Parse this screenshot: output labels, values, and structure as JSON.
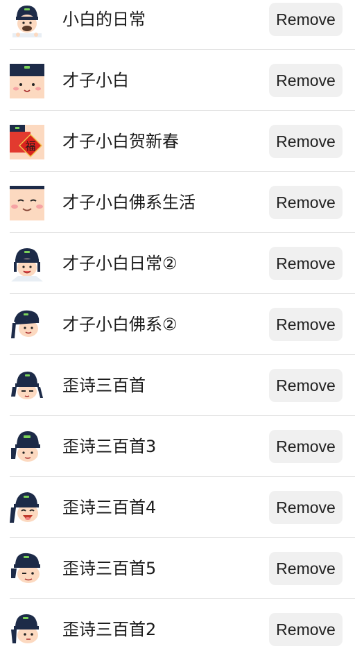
{
  "sticker_list": {
    "remove_label": "Remove",
    "items": [
      {
        "name": "小白的日常",
        "icon": "scholar-eating-icon"
      },
      {
        "name": "才子小白",
        "icon": "scholar-face-icon"
      },
      {
        "name": "才子小白贺新春",
        "icon": "scholar-fu-newyear-icon"
      },
      {
        "name": "才子小白佛系生活",
        "icon": "scholar-smiling-face-icon"
      },
      {
        "name": "才子小白日常②",
        "icon": "scholar-hat-smile-icon"
      },
      {
        "name": "才子小白佛系②",
        "icon": "scholar-tilted-hat-icon"
      },
      {
        "name": "歪诗三百首",
        "icon": "poet-cap-icon"
      },
      {
        "name": "歪诗三百首3",
        "icon": "poet-cap-green-icon"
      },
      {
        "name": "歪诗三百首4",
        "icon": "poet-laughing-icon"
      },
      {
        "name": "歪诗三百首5",
        "icon": "poet-winking-icon"
      },
      {
        "name": "歪诗三百首2",
        "icon": "poet-side-glance-icon"
      }
    ]
  },
  "colors": {
    "hat": "#1d2b48",
    "skin": "#fcd9c0",
    "button_bg": "#f0f0f0",
    "divider": "#e2e2e2",
    "fu_red": "#d9231d"
  }
}
